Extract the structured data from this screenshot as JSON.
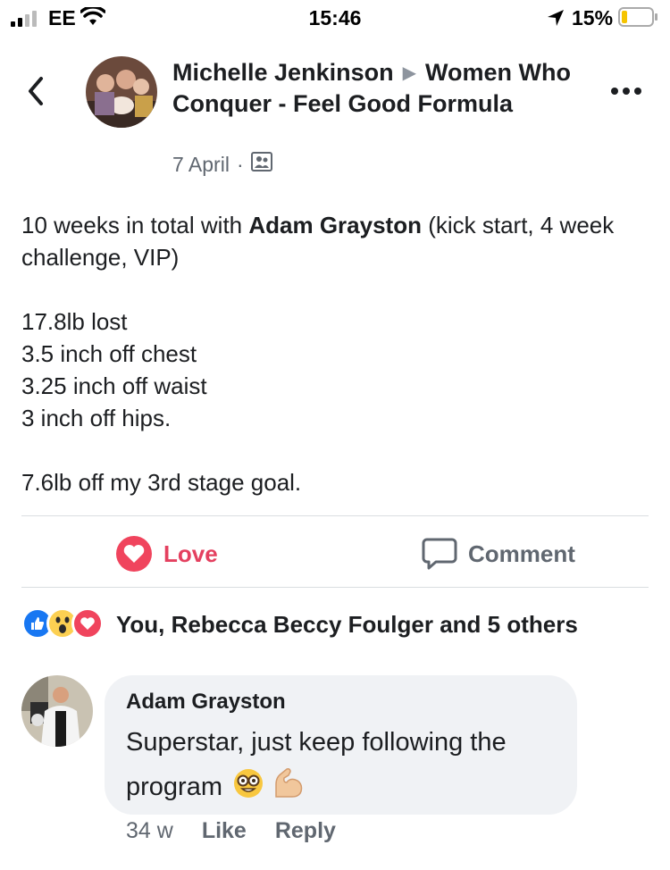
{
  "status_bar": {
    "carrier": "EE",
    "time": "15:46",
    "battery": "15%"
  },
  "post": {
    "author": "Michelle Jenkinson",
    "group": "Women Who Conquer - Feel Good Formula",
    "date": "7 April",
    "separator": "·",
    "intro_before": "10 weeks in total with ",
    "mention": "Adam Grayston",
    "intro_after": " (kick start, 4 week challenge, VIP)",
    "stats": [
      "17.8lb lost",
      "3.5 inch off chest",
      "3.25 inch off waist",
      "3 inch off hips."
    ],
    "goal": "7.6lb off my 3rd stage goal."
  },
  "actions": {
    "love": "Love",
    "comment": "Comment"
  },
  "reactions": {
    "text": "You, Rebecca Beccy Foulger and 5 others"
  },
  "comment": {
    "author": "Adam Grayston",
    "text": "Superstar, just keep following the program",
    "emojis": [
      "nerd-face",
      "flexed-biceps"
    ],
    "age": "34 w",
    "like": "Like",
    "reply": "Reply"
  },
  "colors": {
    "love": "#e4405f",
    "like_blue": "#1877f2",
    "muted": "#606770",
    "bubble": "#f0f2f5"
  }
}
